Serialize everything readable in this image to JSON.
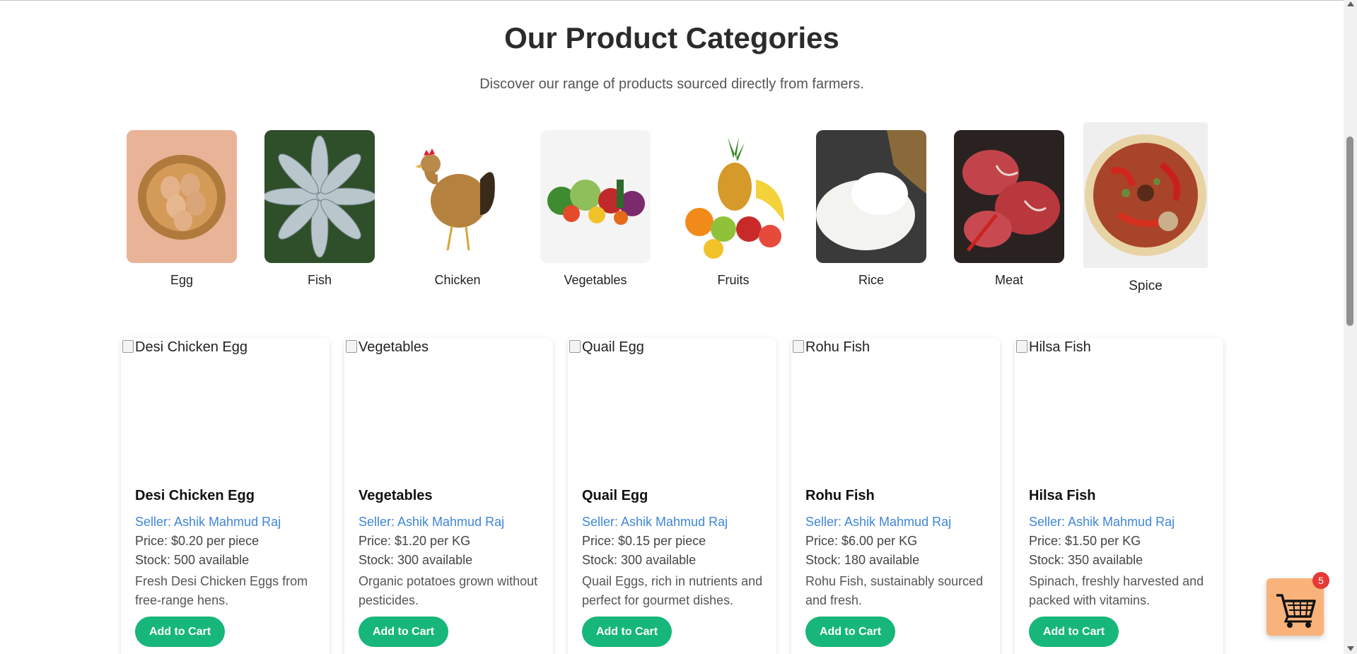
{
  "header": {
    "title": "Our Product Categories",
    "subtitle": "Discover our range of products sourced directly from farmers."
  },
  "categories": [
    {
      "label": "Egg",
      "icon": "egg-basket-image"
    },
    {
      "label": "Fish",
      "icon": "fish-image"
    },
    {
      "label": "Chicken",
      "icon": "chicken-image"
    },
    {
      "label": "Vegetables",
      "icon": "vegetables-image"
    },
    {
      "label": "Fruits",
      "icon": "fruits-image"
    },
    {
      "label": "Rice",
      "icon": "rice-image"
    },
    {
      "label": "Meat",
      "icon": "meat-image"
    },
    {
      "label": "Spice",
      "icon": "spice-image"
    }
  ],
  "products": [
    {
      "alt": "Desi Chicken Egg",
      "title": "Desi Chicken Egg",
      "seller": "Seller: Ashik Mahmud Raj",
      "price": "Price: $0.20 per piece",
      "stock": "Stock: 500 available",
      "description": "Fresh Desi Chicken Eggs from free-range hens.",
      "button": "Add to Cart"
    },
    {
      "alt": "Vegetables",
      "title": "Vegetables",
      "seller": "Seller: Ashik Mahmud Raj",
      "price": "Price: $1.20 per KG",
      "stock": "Stock: 300 available",
      "description": "Organic potatoes grown without pesticides.",
      "button": "Add to Cart"
    },
    {
      "alt": "Quail Egg",
      "title": "Quail Egg",
      "seller": "Seller: Ashik Mahmud Raj",
      "price": "Price: $0.15 per piece",
      "stock": "Stock: 300 available",
      "description": "Quail Eggs, rich in nutrients and perfect for gourmet dishes.",
      "button": "Add to Cart"
    },
    {
      "alt": "Rohu Fish",
      "title": "Rohu Fish",
      "seller": "Seller: Ashik Mahmud Raj",
      "price": "Price: $6.00 per KG",
      "stock": "Stock: 180 available",
      "description": "Rohu Fish, sustainably sourced and fresh.",
      "button": "Add to Cart"
    },
    {
      "alt": "Hilsa Fish",
      "title": "Hilsa Fish",
      "seller": "Seller: Ashik Mahmud Raj",
      "price": "Price: $1.50 per KG",
      "stock": "Stock: 350 available",
      "description": "Spinach, freshly harvested and packed with vitamins.",
      "button": "Add to Cart"
    }
  ],
  "cart": {
    "count": "5",
    "icon": "shopping-cart-icon"
  },
  "colors": {
    "accent": "#17b67a",
    "seller_link": "#3f86d8",
    "cart_bg": "#f9b27a",
    "badge": "#e53935"
  }
}
